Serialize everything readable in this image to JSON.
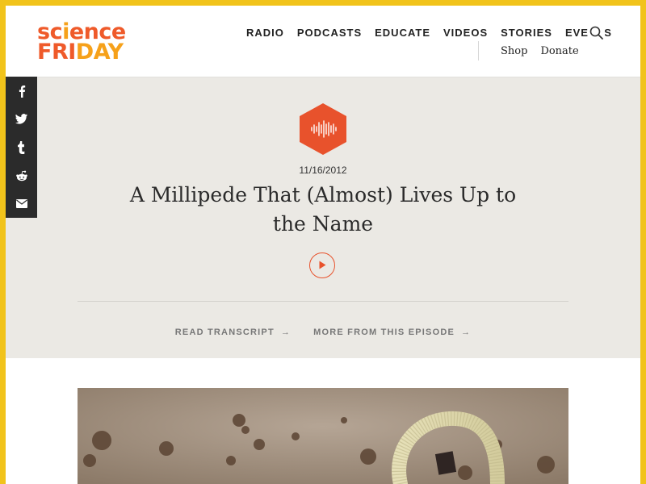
{
  "site": {
    "logo_line1": "SCIENCE",
    "logo_line2": "FRIDAY",
    "brand_colors": {
      "accent": "#ef5a2a",
      "secondary": "#f6a11a",
      "frame": "#f1c31b"
    }
  },
  "nav": {
    "items": [
      {
        "label": "RADIO"
      },
      {
        "label": "PODCASTS"
      },
      {
        "label": "EDUCATE"
      },
      {
        "label": "VIDEOS"
      },
      {
        "label": "STORIES"
      },
      {
        "label": "EVENTS"
      }
    ],
    "search_icon": "search-icon",
    "sub_items": [
      {
        "label": "Shop"
      },
      {
        "label": "Donate"
      }
    ]
  },
  "share": {
    "icons": [
      "facebook-icon",
      "twitter-icon",
      "tumblr-icon",
      "reddit-icon",
      "email-icon"
    ]
  },
  "segment": {
    "badge_icon": "audio-waveform-icon",
    "date": "11/16/2012",
    "title": "A Millipede That (Almost) Lives Up to the Name",
    "play_icon": "play-icon",
    "links": [
      {
        "label": "READ TRANSCRIPT"
      },
      {
        "label": "MORE FROM THIS EPISODE"
      }
    ]
  },
  "image": {
    "subject": "millipede-photo"
  }
}
